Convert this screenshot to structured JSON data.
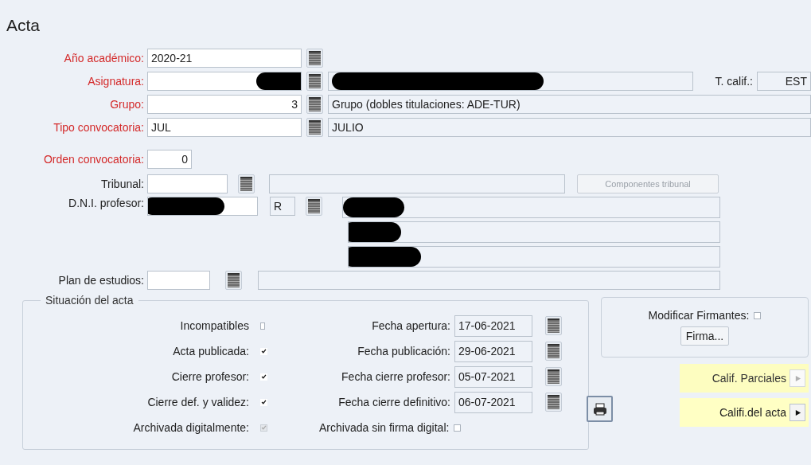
{
  "title": "Acta",
  "anio_academico": {
    "label": "Año académico:",
    "required": true,
    "value": "2020-21"
  },
  "asignatura": {
    "label": "Asignatura:",
    "required": true
  },
  "t_calif": {
    "label": "T. calif.:",
    "value": "EST"
  },
  "grupo": {
    "label": "Grupo:",
    "required": true,
    "value": "3",
    "description": "Grupo (dobles titulaciones: ADE-TUR)"
  },
  "tipo_convocatoria": {
    "label": "Tipo convocatoria:",
    "required": true,
    "value": "JUL",
    "description": "JULIO"
  },
  "orden_convocatoria": {
    "label": "Orden convocatoria:",
    "required": true,
    "value": "0"
  },
  "tribunal": {
    "label": "Tribunal:",
    "required": false,
    "button": {
      "label": "Componentes tribunal",
      "disabled": true
    }
  },
  "dni_profesor": {
    "label": "D.N.I. profesor:",
    "required": false,
    "letter": "R"
  },
  "plan_estudios": {
    "label": "Plan de estudios:",
    "required": false
  },
  "situacion": {
    "legend": "Situación del acta",
    "checks": [
      {
        "label": "Incompatibles",
        "checked": false,
        "disabled": false
      },
      {
        "label": "Acta publicada:",
        "checked": true,
        "disabled": false
      },
      {
        "label": "Cierre profesor:",
        "checked": true,
        "disabled": false
      },
      {
        "label": "Cierre def. y validez:",
        "checked": true,
        "disabled": false
      },
      {
        "label": "Archivada digitalmente:",
        "checked": true,
        "disabled": true
      }
    ],
    "dates": [
      {
        "label": "Fecha apertura:",
        "value": "17-06-2021"
      },
      {
        "label": "Fecha publicación:",
        "value": "29-06-2021"
      },
      {
        "label": "Fecha cierre profesor:",
        "value": "05-07-2021"
      },
      {
        "label": "Fecha cierre definitivo:",
        "value": "06-07-2021"
      }
    ],
    "archivada_sin_firma": {
      "label": "Archivada sin firma digital:",
      "checked": false
    }
  },
  "modificar_firmantes": {
    "label": "Modificar Firmantes:",
    "checked": false
  },
  "firma_button": "Firma...",
  "calif_buttons": [
    {
      "label": "Calif. Parciales",
      "disabled": true
    },
    {
      "label": "Califi.del acta",
      "disabled": false
    }
  ]
}
